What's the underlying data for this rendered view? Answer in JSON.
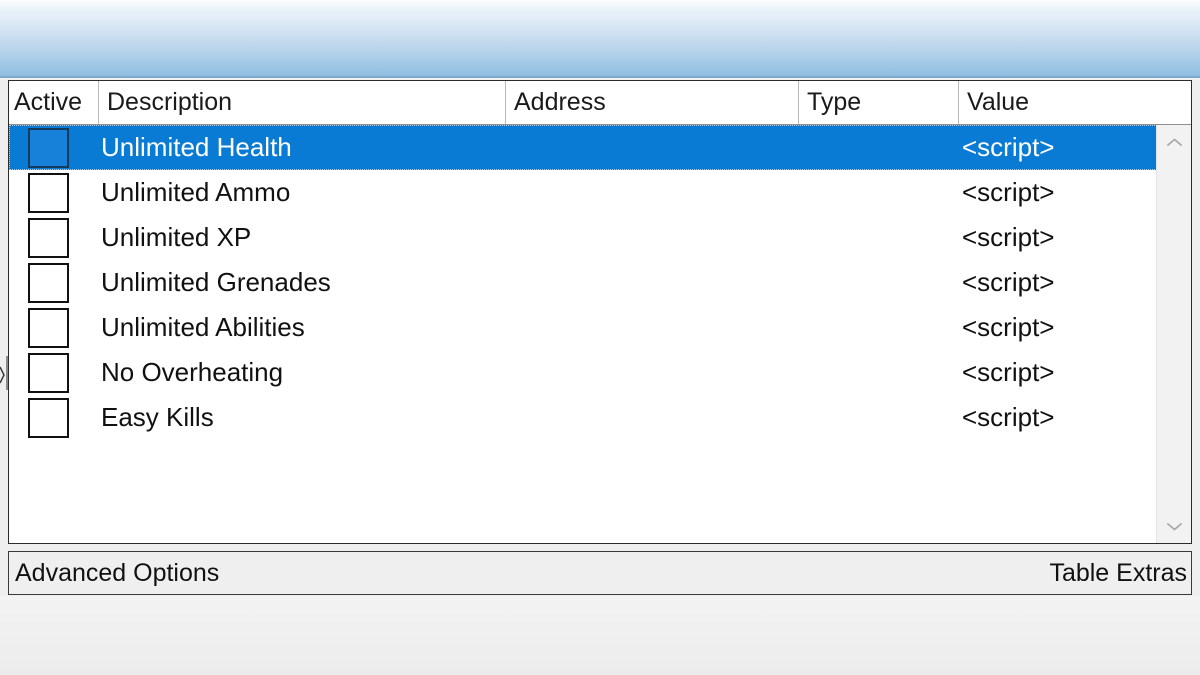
{
  "window": {
    "chrome_gradient_top": "#fbfdfe",
    "chrome_gradient_bottom": "#8ebbdf",
    "selection_color": "#0a7bd4"
  },
  "table": {
    "columns": [
      {
        "key": "active",
        "label": "Active"
      },
      {
        "key": "description",
        "label": "Description"
      },
      {
        "key": "address",
        "label": "Address"
      },
      {
        "key": "type",
        "label": "Type"
      },
      {
        "key": "value",
        "label": "Value"
      }
    ],
    "rows": [
      {
        "active": false,
        "description": "Unlimited Health",
        "address": "",
        "type": "",
        "value": "<script>",
        "selected": true
      },
      {
        "active": false,
        "description": "Unlimited Ammo",
        "address": "",
        "type": "",
        "value": "<script>",
        "selected": false
      },
      {
        "active": false,
        "description": "Unlimited XP",
        "address": "",
        "type": "",
        "value": "<script>",
        "selected": false
      },
      {
        "active": false,
        "description": "Unlimited Grenades",
        "address": "",
        "type": "",
        "value": "<script>",
        "selected": false
      },
      {
        "active": false,
        "description": "Unlimited Abilities",
        "address": "",
        "type": "",
        "value": "<script>",
        "selected": false
      },
      {
        "active": false,
        "description": "No Overheating",
        "address": "",
        "type": "",
        "value": "<script>",
        "selected": false
      },
      {
        "active": false,
        "description": "Easy Kills",
        "address": "",
        "type": "",
        "value": "<script>",
        "selected": false
      }
    ]
  },
  "scrollbar": {
    "up_icon": "chevron-up-icon",
    "down_icon": "chevron-down-icon"
  },
  "statusbar": {
    "advanced_options_label": "Advanced Options",
    "table_extras_label": "Table Extras"
  }
}
